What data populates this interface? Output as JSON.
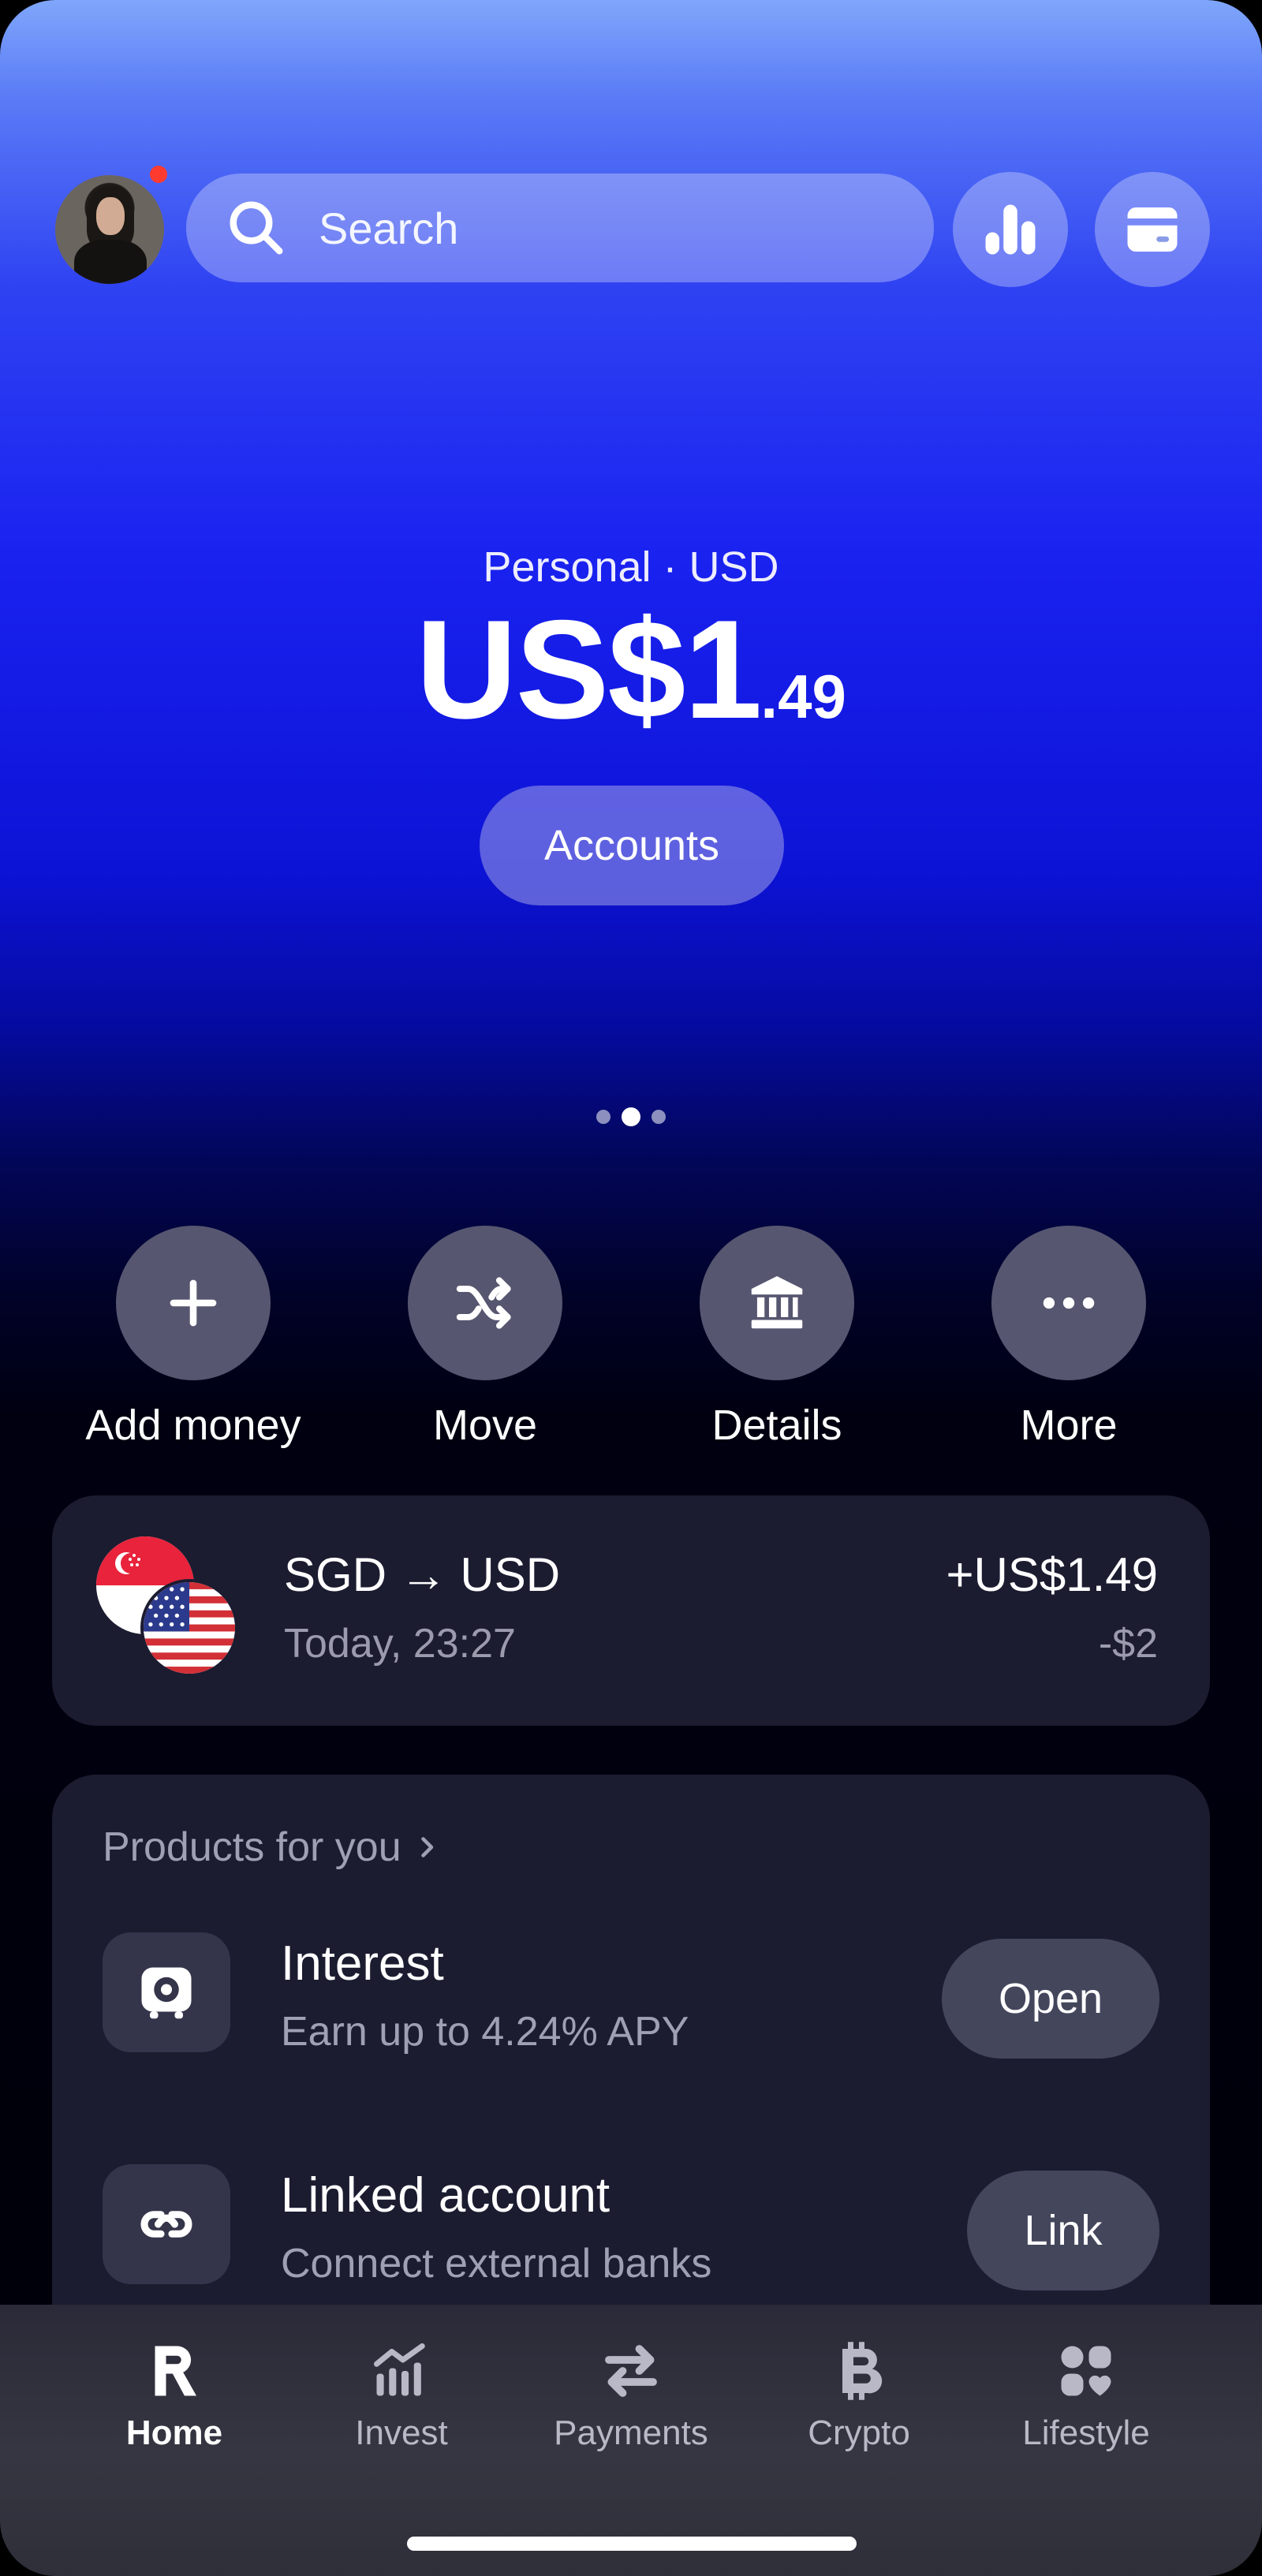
{
  "header": {
    "search_placeholder": "Search",
    "icons": [
      "search-icon",
      "bar-chart-icon",
      "card-icon"
    ],
    "notification_color": "#ff3b30"
  },
  "balance": {
    "account_label": "Personal · USD",
    "amount_main": "US$1",
    "amount_cents": ".49",
    "accounts_button": "Accounts",
    "page_indicator": {
      "count": 3,
      "active_index": 1
    }
  },
  "actions": [
    {
      "label": "Add money",
      "icon": "plus-icon"
    },
    {
      "label": "Move",
      "icon": "shuffle-icon"
    },
    {
      "label": "Details",
      "icon": "bank-icon"
    },
    {
      "label": "More",
      "icon": "more-icon"
    }
  ],
  "transaction": {
    "title": "SGD → USD",
    "time": "Today, 23:27",
    "amount": "+US$1.49",
    "fee": "-$2"
  },
  "products": {
    "header": "Products for you",
    "items": [
      {
        "title": "Interest",
        "subtitle": "Earn up to 4.24% APY",
        "button": "Open",
        "icon": "safe-icon"
      },
      {
        "title": "Linked account",
        "subtitle": "Connect external banks",
        "button": "Link",
        "icon": "link-icon"
      }
    ]
  },
  "nav": {
    "items": [
      {
        "label": "Home",
        "icon": "revolut-r-icon",
        "active": true
      },
      {
        "label": "Invest",
        "icon": "invest-chart-icon",
        "active": false
      },
      {
        "label": "Payments",
        "icon": "transfer-arrows-icon",
        "active": false
      },
      {
        "label": "Crypto",
        "icon": "bitcoin-icon",
        "active": false
      },
      {
        "label": "Lifestyle",
        "icon": "lifestyle-grid-icon",
        "active": false
      }
    ]
  },
  "colors": {
    "accent_blue": "#1a22f0",
    "card_bg": "#1b1c30"
  }
}
